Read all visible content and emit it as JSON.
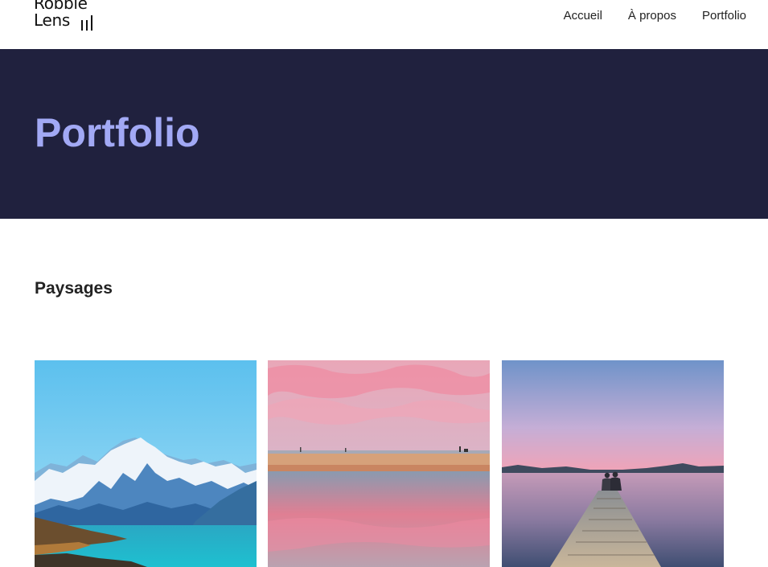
{
  "header": {
    "logo": {
      "line1": "Robbie",
      "line2": "Lens"
    },
    "nav": [
      {
        "label": "Accueil"
      },
      {
        "label": "À propos"
      },
      {
        "label": "Portfolio"
      }
    ]
  },
  "hero": {
    "title": "Portfolio",
    "background_color": "#20213e",
    "title_color": "#a2a9f5"
  },
  "section": {
    "title": "Paysages"
  },
  "gallery": {
    "photos": [
      {
        "subject": "snowy-mountain-lake-photo"
      },
      {
        "subject": "pink-sunset-beach-reflection-photo"
      },
      {
        "subject": "couple-on-pier-lake-dusk-photo"
      }
    ]
  }
}
